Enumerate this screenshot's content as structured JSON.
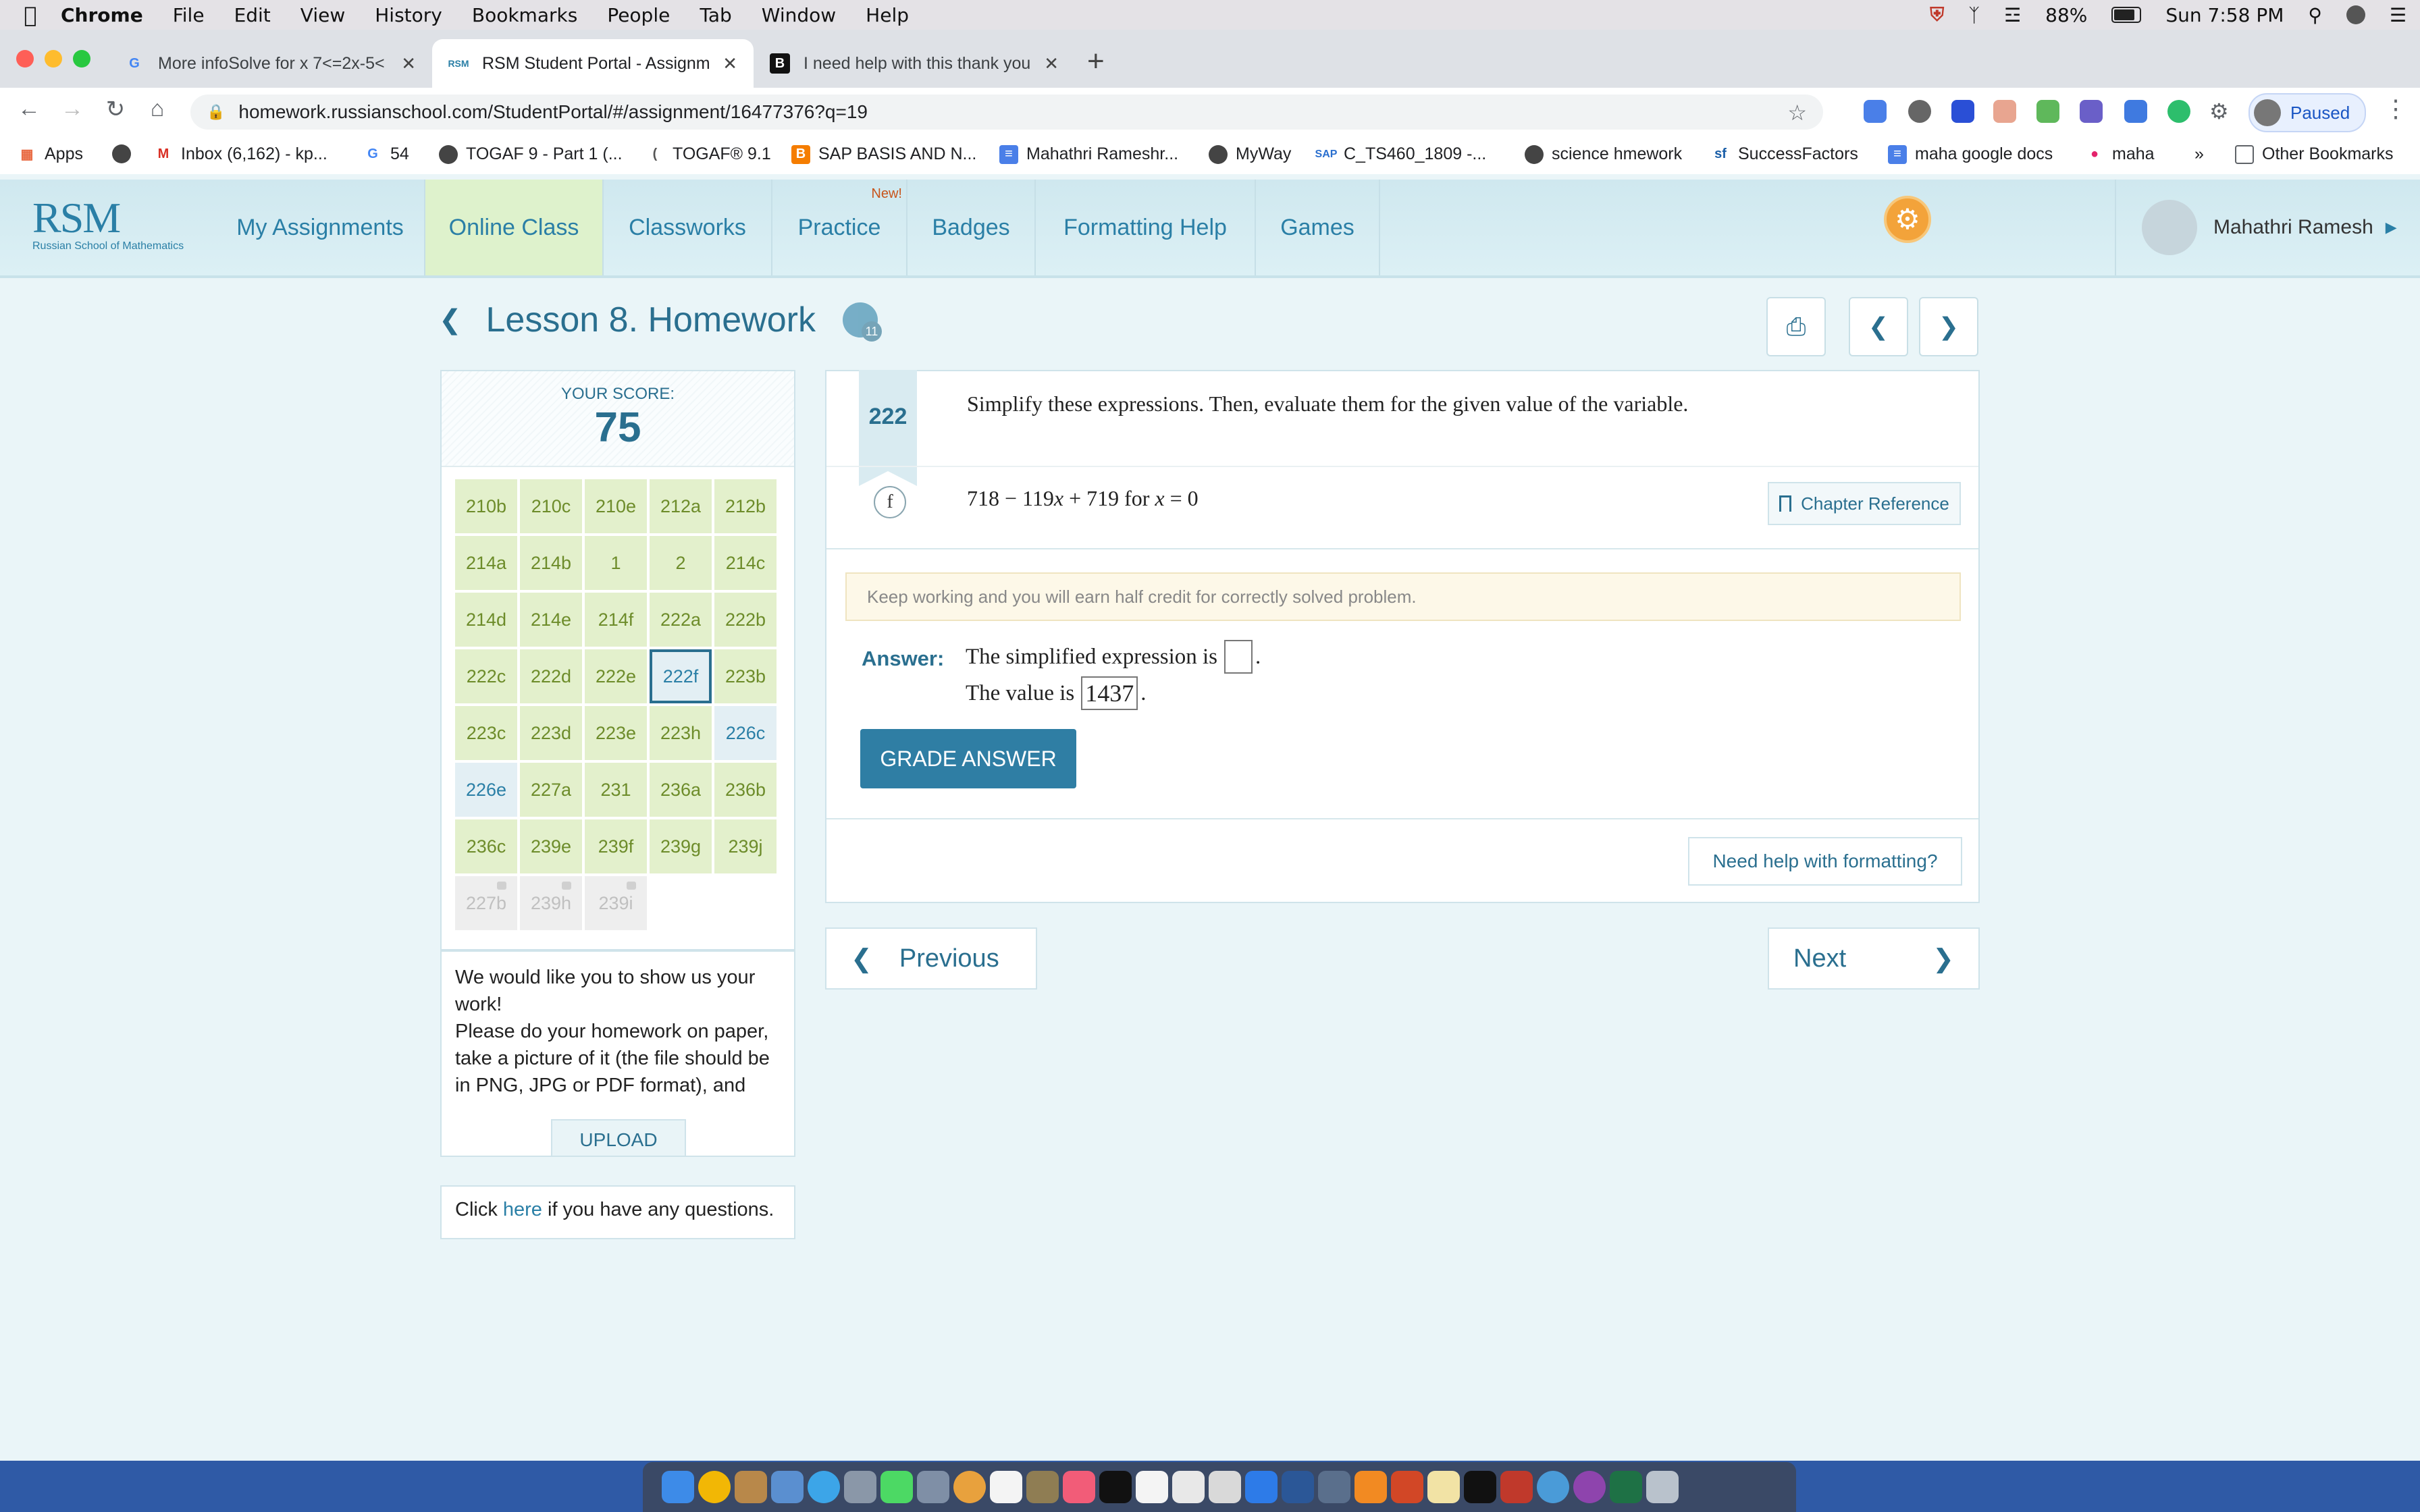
{
  "menubar": {
    "app": "Chrome",
    "items": [
      "File",
      "Edit",
      "View",
      "History",
      "Bookmarks",
      "People",
      "Tab",
      "Window",
      "Help"
    ],
    "battery": "88%",
    "clock": "Sun 7:58 PM"
  },
  "tabs": [
    {
      "label": "More infoSolve for x 7<=2x-5<",
      "active": false
    },
    {
      "label": "RSM Student Portal - Assignm",
      "active": true
    },
    {
      "label": "I need help with this thank you",
      "active": false
    }
  ],
  "address": {
    "url": "homework.russianschool.com/StudentPortal/#/assignment/16477376?q=19"
  },
  "profile": {
    "label": "Paused"
  },
  "bookmarks": [
    {
      "label": "Apps",
      "icon": "apps-grid-icon"
    },
    {
      "label": "",
      "icon": "globe-icon"
    },
    {
      "label": "Inbox (6,162) - kp...",
      "icon": "gmail-icon"
    },
    {
      "label": "54",
      "icon": "google-icon"
    },
    {
      "label": "TOGAF 9 - Part 1 (...",
      "icon": "globe-icon"
    },
    {
      "label": "TOGAF® 9.1",
      "icon": "togaf-icon"
    },
    {
      "label": "SAP BASIS AND N...",
      "icon": "blogger-icon"
    },
    {
      "label": "Mahathri Rameshr...",
      "icon": "docs-icon"
    },
    {
      "label": "MyWay",
      "icon": "globe-icon"
    },
    {
      "label": "C_TS460_1809 -...",
      "icon": "sap-icon"
    },
    {
      "label": "science hmework",
      "icon": "globe-icon"
    },
    {
      "label": "SuccessFactors",
      "icon": "sf-icon"
    },
    {
      "label": "maha google docs",
      "icon": "docs-icon"
    },
    {
      "label": "maha",
      "icon": "flickr-icon"
    }
  ],
  "bookmarks_more": "»",
  "other_bookmarks": "Other Bookmarks",
  "site": {
    "logo": "RSM",
    "logo_tagline": "Russian School of Mathematics",
    "nav": [
      "My Assignments",
      "Online Class",
      "Classworks",
      "Practice",
      "Badges",
      "Formatting Help",
      "Games"
    ],
    "new_badge": "New!",
    "user": "Mahathri Ramesh"
  },
  "lesson": {
    "title": "Lesson 8. Homework",
    "badge_count": "11"
  },
  "score": {
    "label": "YOUR SCORE:",
    "value": "75"
  },
  "problems": [
    {
      "id": "210b",
      "state": "done"
    },
    {
      "id": "210c",
      "state": "done"
    },
    {
      "id": "210e",
      "state": "done"
    },
    {
      "id": "212a",
      "state": "done"
    },
    {
      "id": "212b",
      "state": "done"
    },
    {
      "id": "214a",
      "state": "done"
    },
    {
      "id": "214b",
      "state": "done"
    },
    {
      "id": "1",
      "state": "done"
    },
    {
      "id": "2",
      "state": "done"
    },
    {
      "id": "214c",
      "state": "done"
    },
    {
      "id": "214d",
      "state": "done"
    },
    {
      "id": "214e",
      "state": "done"
    },
    {
      "id": "214f",
      "state": "done"
    },
    {
      "id": "222a",
      "state": "done"
    },
    {
      "id": "222b",
      "state": "done"
    },
    {
      "id": "222c",
      "state": "done"
    },
    {
      "id": "222d",
      "state": "done"
    },
    {
      "id": "222e",
      "state": "done"
    },
    {
      "id": "222f",
      "state": "selected"
    },
    {
      "id": "223b",
      "state": "done"
    },
    {
      "id": "223c",
      "state": "done"
    },
    {
      "id": "223d",
      "state": "done"
    },
    {
      "id": "223e",
      "state": "done"
    },
    {
      "id": "223h",
      "state": "done"
    },
    {
      "id": "226c",
      "state": "open"
    },
    {
      "id": "226e",
      "state": "open"
    },
    {
      "id": "227a",
      "state": "done"
    },
    {
      "id": "231",
      "state": "done"
    },
    {
      "id": "236a",
      "state": "done"
    },
    {
      "id": "236b",
      "state": "done"
    },
    {
      "id": "236c",
      "state": "done"
    },
    {
      "id": "239e",
      "state": "done"
    },
    {
      "id": "239f",
      "state": "done"
    },
    {
      "id": "239g",
      "state": "done"
    },
    {
      "id": "239j",
      "state": "done"
    },
    {
      "id": "227b",
      "state": "locked"
    },
    {
      "id": "239h",
      "state": "locked"
    },
    {
      "id": "239i",
      "state": "locked"
    }
  ],
  "upload": {
    "text": "We would like you to show us your work!\nPlease do your homework on paper, take a picture of it (the file should be in PNG, JPG or PDF format), and",
    "button": "UPLOAD"
  },
  "questions": {
    "before": "Click ",
    "link": "here",
    "after": " if you have any questions."
  },
  "problem": {
    "number": "222",
    "instruction": "Simplify these expressions. Then, evaluate them for the given value of the variable.",
    "part": "f",
    "expression": "718 − 119x + 719 for x = 0",
    "chapter_ref": "Chapter Reference",
    "warning": "Keep working and you will earn half credit for correctly solved problem.",
    "answer_label": "Answer:",
    "line1": "The simplified expression is",
    "answer1": "",
    "line2": "The value is",
    "answer2": "1437",
    "grade_button": "GRADE ANSWER",
    "help_button": "Need help with formatting?"
  },
  "pager": {
    "previous": "Previous",
    "next": "Next"
  },
  "colors": {
    "accent": "#2a6f8f",
    "done": "#e3f0cc",
    "button": "#2f7ea4"
  }
}
